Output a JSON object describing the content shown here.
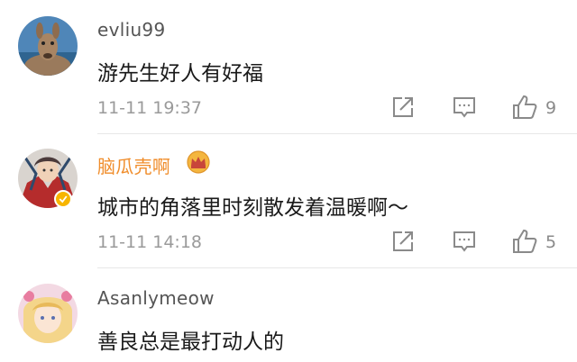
{
  "comments": [
    {
      "username": "evliu99",
      "text": "游先生好人有好福",
      "time": "11-11 19:37",
      "likes": "9"
    },
    {
      "username": "脑瓜壳啊",
      "text": "城市的角落里时刻散发着温暖啊～",
      "time": "11-11 14:18",
      "likes": "5"
    },
    {
      "username": "Asanlymeow",
      "text": "善良总是最打动人的"
    }
  ],
  "icons": {
    "share": "share-icon",
    "comment": "comment-icon",
    "like": "thumbs-up-icon",
    "vip": "crown-icon",
    "verified": "verified-badge-icon"
  },
  "colors": {
    "vip_username": "#f08d2b",
    "username": "#555555",
    "timestamp": "#9a9a9a",
    "icon": "#8a8a8a",
    "verified_badge": "#f7b500"
  }
}
